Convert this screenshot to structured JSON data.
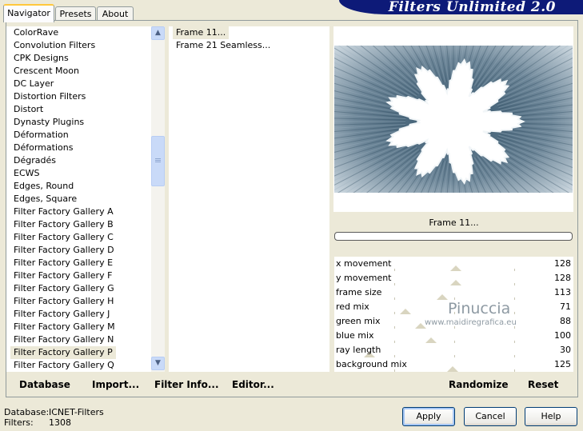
{
  "header": {
    "banner_text": "Filters Unlimited 2.0"
  },
  "tabs": [
    {
      "label": "Navigator",
      "active": true
    },
    {
      "label": "Presets",
      "active": false
    },
    {
      "label": "About",
      "active": false
    }
  ],
  "categories": {
    "items": [
      "ColorRave",
      "Convolution Filters",
      "CPK Designs",
      "Crescent Moon",
      "DC Layer",
      "Distortion Filters",
      "Distort",
      "Dynasty Plugins",
      "Déformation",
      "Déformations",
      "Dégradés",
      "ECWS",
      "Edges, Round",
      "Edges, Square",
      "Filter Factory Gallery A",
      "Filter Factory Gallery B",
      "Filter Factory Gallery C",
      "Filter Factory Gallery D",
      "Filter Factory Gallery E",
      "Filter Factory Gallery F",
      "Filter Factory Gallery G",
      "Filter Factory Gallery H",
      "Filter Factory Gallery J",
      "Filter Factory Gallery M",
      "Filter Factory Gallery N",
      "Filter Factory Gallery P",
      "Filter Factory Gallery Q"
    ],
    "selected": "Filter Factory Gallery P"
  },
  "filters": {
    "items": [
      "Frame 11...",
      "Frame 21 Seamless..."
    ],
    "selected": "Frame 11..."
  },
  "actions": {
    "database": "Database",
    "import": "Import...",
    "filter_info": "Filter Info...",
    "editor": "Editor..."
  },
  "preview": {
    "filter_name": "Frame 11...",
    "progress": 0
  },
  "parameters": [
    {
      "label": "x movement",
      "value": 128
    },
    {
      "label": "y movement",
      "value": 128
    },
    {
      "label": "frame size",
      "value": 113
    },
    {
      "label": "red mix",
      "value": 71
    },
    {
      "label": "green mix",
      "value": 88
    },
    {
      "label": "blue mix",
      "value": 100
    },
    {
      "label": "ray length",
      "value": 30
    },
    {
      "label": "background mix",
      "value": 125
    }
  ],
  "watermark": {
    "line1": "Pinuccia",
    "line2": "www.maidiregrafica.eu"
  },
  "param_buttons": {
    "randomize": "Randomize",
    "reset": "Reset"
  },
  "footer": {
    "database_label": "Database:",
    "database_value": "ICNET-Filters",
    "filters_label": "Filters:",
    "filters_value": "1308"
  },
  "dialog_buttons": {
    "apply": "Apply",
    "cancel": "Cancel",
    "help": "Help"
  },
  "colors": {
    "banner": "#0d1a78",
    "tab_highlight": "#FFC83C",
    "preview_tint": "#5a7486"
  }
}
